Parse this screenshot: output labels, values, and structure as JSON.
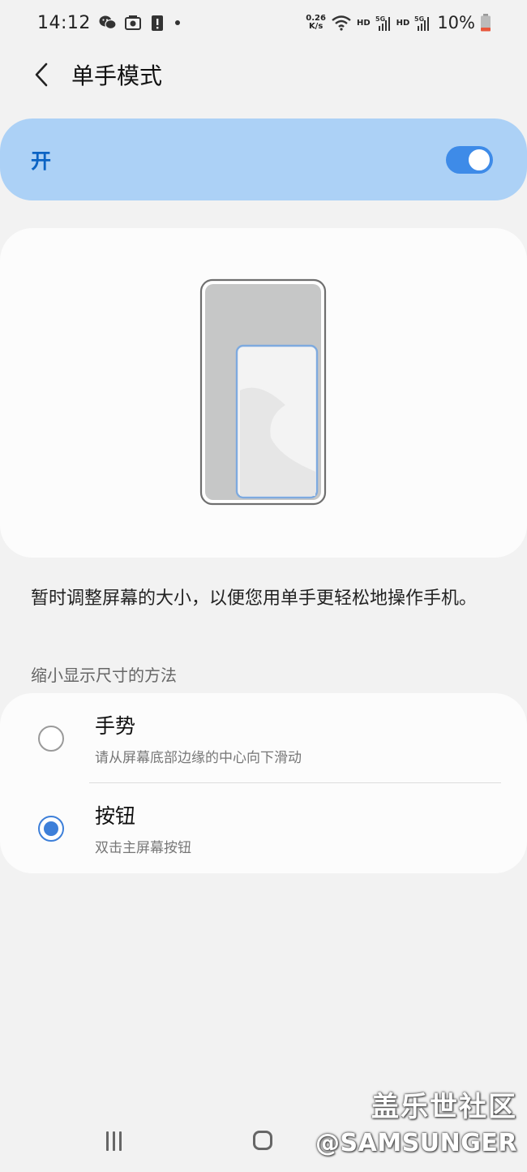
{
  "status_bar": {
    "time": "14:12",
    "net_speed_value": "0.26",
    "net_speed_unit": "K/s",
    "hd1": "HD",
    "signal1": "5G",
    "hd2": "HD",
    "signal2": "5G",
    "battery": "10%",
    "icons": [
      "wechat-icon",
      "alarm-icon",
      "alert-icon",
      "dot-icon",
      "wifi-icon",
      "signal-icon",
      "battery-icon"
    ]
  },
  "header": {
    "title": "单手模式"
  },
  "master_switch": {
    "label": "开",
    "state": "on"
  },
  "description": "暂时调整屏幕的大小，以便您用单手更轻松地操作手机。",
  "section_title": "缩小显示尺寸的方法",
  "options": [
    {
      "title": "手势",
      "subtitle": "请从屏幕底部边缘的中心向下滑动",
      "selected": false
    },
    {
      "title": "按钮",
      "subtitle": "双击主屏幕按钮",
      "selected": true
    }
  ],
  "watermark": {
    "line1": "盖乐世社区",
    "line2": "@SAMSUNGER"
  },
  "colors": {
    "accent": "#3e8be8",
    "toggle_bg": "#acd1f6",
    "label_blue": "#0b63c4",
    "background": "#f2f2f2",
    "card": "#fcfcfc"
  }
}
